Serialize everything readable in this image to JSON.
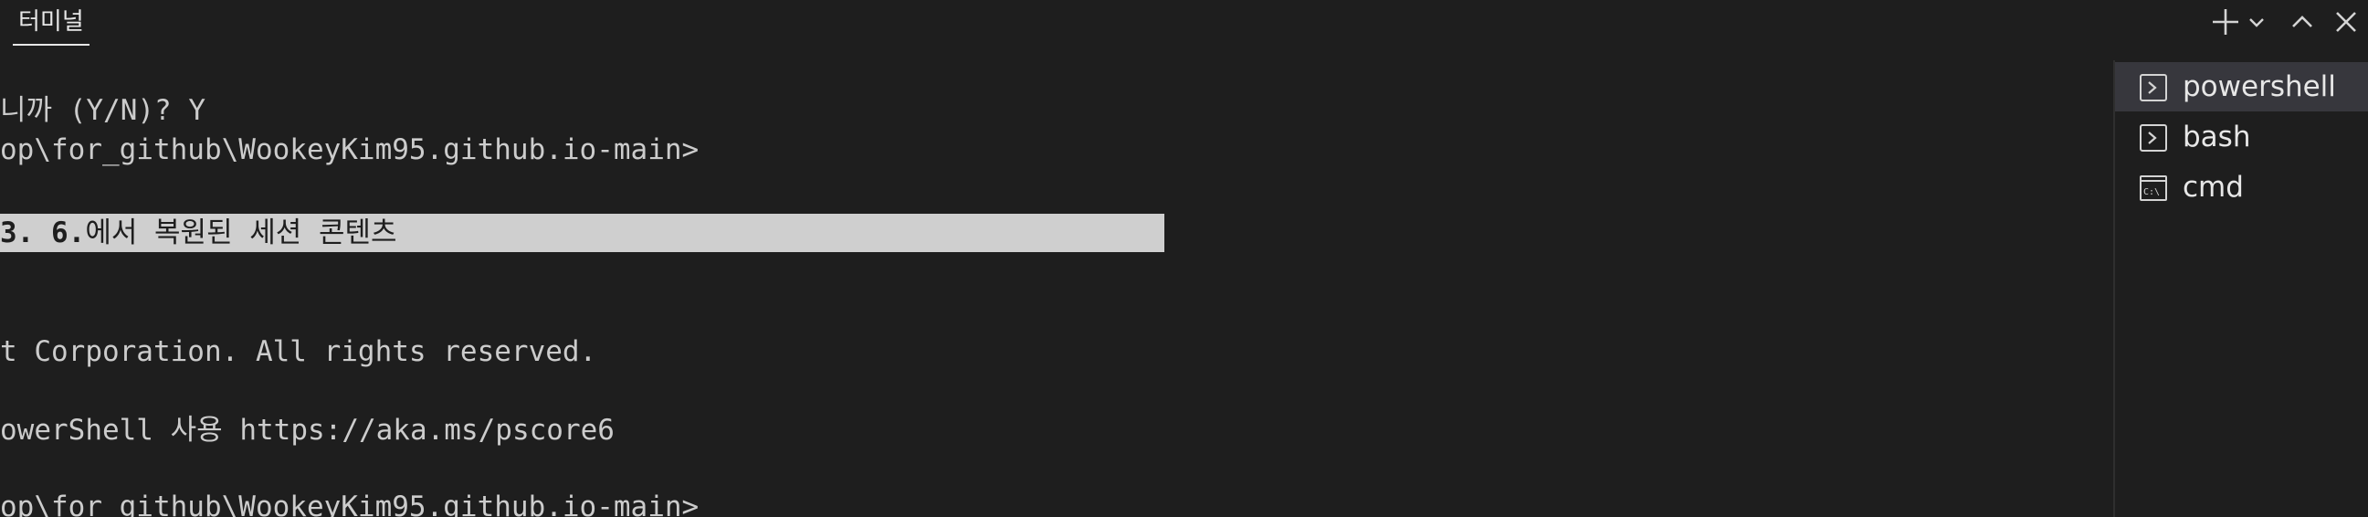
{
  "panel_tab": "터미널",
  "output_lines": [
    "니까 (Y/N)? Y",
    "op\\for_github\\WookeyKim95.github.io-main>",
    "",
    "",
    "",
    "t Corporation. All rights reserved.",
    "",
    "owerShell 사용 https://aka.ms/pscore6",
    "",
    "op\\for_github\\WookeyKim95.github.io-main>"
  ],
  "restored_banner": {
    "date": "3. 6.",
    "text": "에서 복원된 세션 콘텐츠"
  },
  "terminals": [
    {
      "label": "powershell",
      "icon": "terminal-prompt-icon",
      "active": true
    },
    {
      "label": "bash",
      "icon": "terminal-prompt-icon",
      "active": false
    },
    {
      "label": "cmd",
      "icon": "cmd-icon",
      "active": false
    }
  ],
  "colors": {
    "background": "#1e1e1e",
    "text": "#cccccc",
    "highlight_bg": "#cfcfcf",
    "active_item_bg": "#37373d"
  }
}
